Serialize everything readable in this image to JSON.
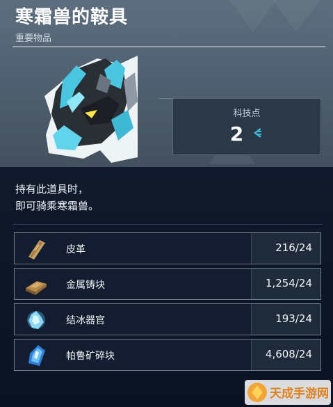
{
  "item": {
    "name": "寒霜兽的鞍具",
    "category": "重要物品",
    "image_icon": "frostallion-saddle-icon",
    "description_lines": [
      "持有此道具时，",
      "即可骑乘寒霜兽。"
    ]
  },
  "tech_points": {
    "label": "科技点",
    "value": "2",
    "icon": "tech-point-icon"
  },
  "materials": [
    {
      "name": "皮革",
      "count": "216/24",
      "icon": "leather-icon"
    },
    {
      "name": "金属铸块",
      "count": "1,254/24",
      "icon": "ingot-icon"
    },
    {
      "name": "结冰器官",
      "count": "193/24",
      "icon": "ice-organ-icon"
    },
    {
      "name": "帕鲁矿碎块",
      "count": "4,608/24",
      "icon": "pal-fluid-shard-icon"
    }
  ],
  "watermark": {
    "text": "天成手游网"
  },
  "colors": {
    "accent": "#3ab8d6",
    "panel_top": "#4e5e6e",
    "panel_bottom": "#0c1424"
  }
}
